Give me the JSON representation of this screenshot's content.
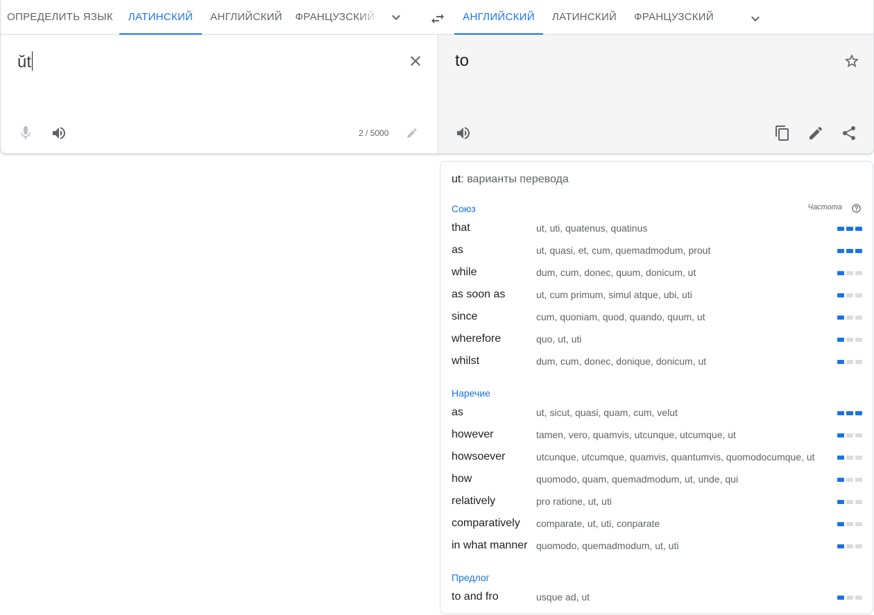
{
  "source_langs": {
    "tabs": [
      "ОПРЕДЕЛИТЬ ЯЗЫК",
      "ЛАТИНСКИЙ",
      "АНГЛИЙСКИЙ",
      "ФРАНЦУЗСКИЙ"
    ],
    "active_index": 1
  },
  "target_langs": {
    "tabs": [
      "АНГЛИЙСКИЙ",
      "ЛАТИНСКИЙ",
      "ФРАНЦУЗСКИЙ"
    ],
    "active_index": 0
  },
  "source": {
    "text": "ŭt",
    "char_count": "2 / 5000"
  },
  "target": {
    "text": "to"
  },
  "icons": {
    "expand_source": "chevron-down-icon",
    "swap": "swap-icon",
    "expand_target": "chevron-down-icon",
    "clear": "close-icon",
    "mic": "mic-icon",
    "listen_source": "speaker-icon",
    "edit": "pencil-icon",
    "star": "star-icon",
    "listen_target": "speaker-icon",
    "copy": "copy-icon",
    "edit_translation": "pencil-icon",
    "share": "share-icon",
    "help": "help-circle-icon"
  },
  "colors": {
    "accent": "#1a73e8",
    "bar_off": "#dadce0",
    "target_bg": "#f5f5f5"
  },
  "dictionary": {
    "word": "ut",
    "title_suffix": ": варианты перевода",
    "frequency_label": "Частота",
    "sections": [
      {
        "pos": "Союз",
        "entries": [
          {
            "word": "that",
            "translations": "ut, uti, quatenus, quatinus",
            "frequency": 3
          },
          {
            "word": "as",
            "translations": "ut, quasi, et, cum, quemadmodum, prout",
            "frequency": 3
          },
          {
            "word": "while",
            "translations": "dum, cum, donec, quum, donicum, ut",
            "frequency": 1
          },
          {
            "word": "as soon as",
            "translations": "ut, cum primum, simul atque, ubi, uti",
            "frequency": 1
          },
          {
            "word": "since",
            "translations": "cum, quoniam, quod, quando, quum, ut",
            "frequency": 1
          },
          {
            "word": "wherefore",
            "translations": "quo, ut, uti",
            "frequency": 1
          },
          {
            "word": "whilst",
            "translations": "dum, cum, donec, donique, donicum, ut",
            "frequency": 1
          }
        ]
      },
      {
        "pos": "Наречие",
        "entries": [
          {
            "word": "as",
            "translations": "ut, sicut, quasi, quam, cum, velut",
            "frequency": 3
          },
          {
            "word": "however",
            "translations": "tamen, vero, quamvis, utcunque, utcumque, ut",
            "frequency": 1
          },
          {
            "word": "howsoever",
            "translations": "utcunque, utcumque, quamvis, quantumvis, quomodocumque, ut",
            "frequency": 1
          },
          {
            "word": "how",
            "translations": "quomodo, quam, quemadmodum, ut, unde, qui",
            "frequency": 1
          },
          {
            "word": "relatively",
            "translations": "pro ratione, ut, uti",
            "frequency": 1
          },
          {
            "word": "comparatively",
            "translations": "comparate, ut, uti, conparate",
            "frequency": 1
          },
          {
            "word": "in what manner",
            "translations": "quomodo, quemadmodum, ut, uti",
            "frequency": 1
          }
        ]
      },
      {
        "pos": "Предлог",
        "entries": [
          {
            "word": "to and fro",
            "translations": "usque ad, ut",
            "frequency": 1
          }
        ]
      }
    ]
  }
}
